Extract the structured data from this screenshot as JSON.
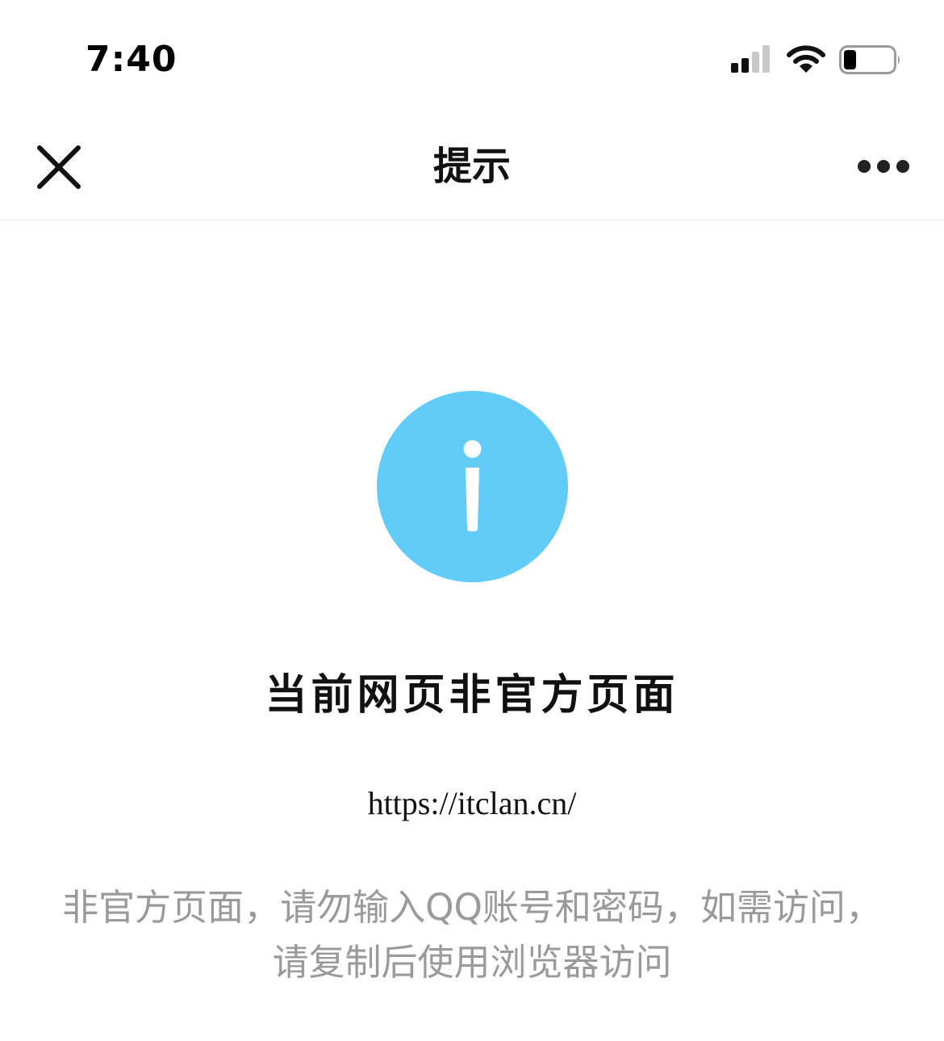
{
  "status_bar": {
    "time": "7:40",
    "signal_icon": "cellular-signal-icon",
    "wifi_icon": "wifi-icon",
    "battery_icon": "battery-low-icon"
  },
  "nav_bar": {
    "close_icon": "close-icon",
    "title": "提示",
    "more_icon": "more-horizontal-icon"
  },
  "content": {
    "icon": "info-icon",
    "icon_color": "#62ccf9",
    "title": "当前网页非官方页面",
    "url": "https://itclan.cn/",
    "message_line1": "非官方页面，请勿输入QQ账号和密码，如需访问，",
    "message_line2": "请复制后使用浏览器访问"
  }
}
